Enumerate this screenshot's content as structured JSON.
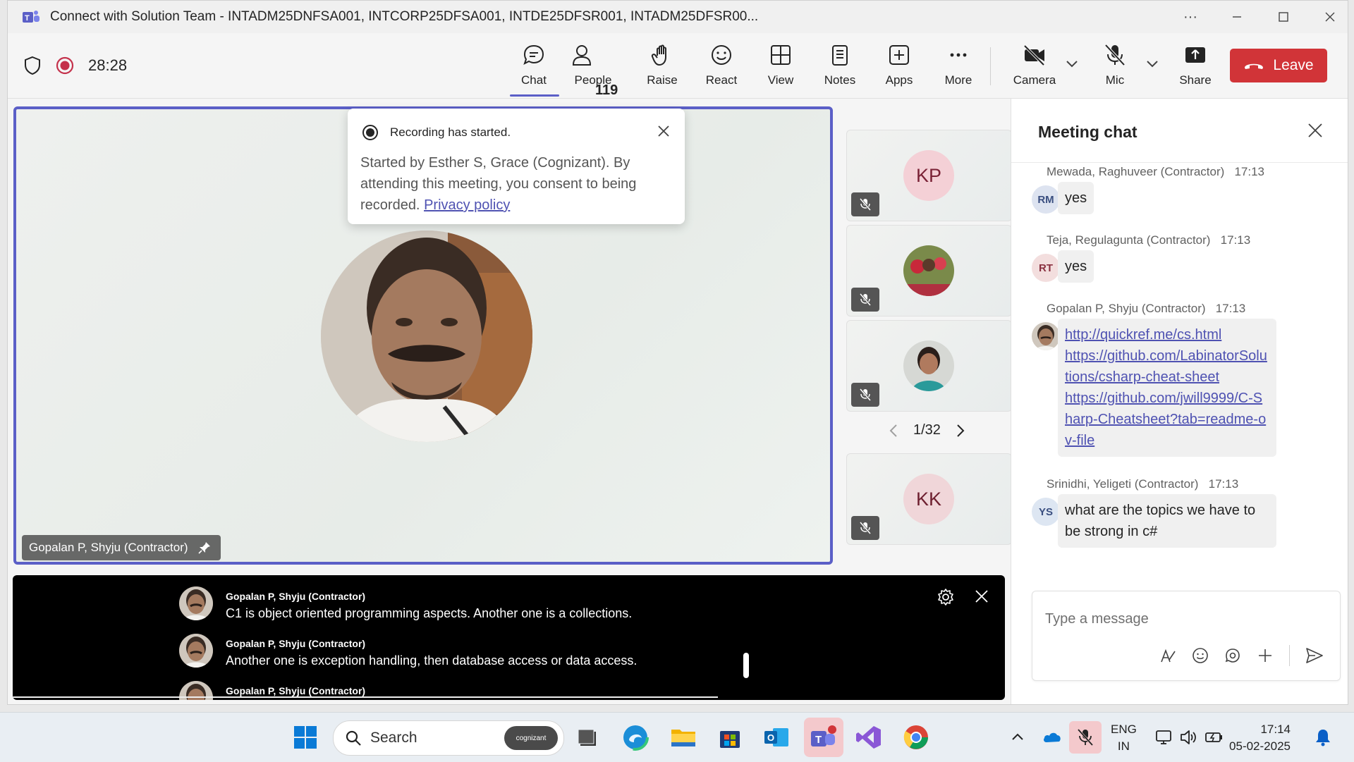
{
  "window": {
    "title": "Connect with Solution Team - INTADM25DNFSA001, INTCORP25DFSA001, INTDE25DFSR001, INTADM25DFSR00..."
  },
  "toolbar": {
    "timer": "28:28",
    "chat": "Chat",
    "people": "People",
    "people_count": "119",
    "raise": "Raise",
    "react": "React",
    "view": "View",
    "notes": "Notes",
    "apps": "Apps",
    "more": "More",
    "camera": "Camera",
    "mic": "Mic",
    "share": "Share",
    "leave": "Leave"
  },
  "toast": {
    "title": "Recording has started.",
    "body": "Started by Esther S, Grace (Cognizant). By attending this meeting, you consent to being recorded.",
    "link": "Privacy policy"
  },
  "stage": {
    "speaker_name": "Gopalan P, Shyju (Contractor)"
  },
  "tiles": [
    {
      "initials": "KP"
    },
    {
      "initials": ""
    },
    {
      "initials": ""
    },
    {
      "initials": "KK"
    }
  ],
  "pager": "1/32",
  "captions": [
    {
      "name": "Gopalan P, Shyju (Contractor)",
      "text": "C1 is object oriented programming aspects. Another one is a collections."
    },
    {
      "name": "Gopalan P, Shyju (Contractor)",
      "text": "Another one is exception handling, then database access or data access."
    },
    {
      "name": "Gopalan P, Shyju (Contractor)",
      "text": ""
    }
  ],
  "chat": {
    "title": "Meeting chat",
    "messages": [
      {
        "sender": "Mewada, Raghuveer (Contractor)",
        "time": "17:13",
        "initials": "RM",
        "text": "yes"
      },
      {
        "sender": "Teja, Regulagunta (Contractor)",
        "time": "17:13",
        "initials": "RT",
        "text": "yes"
      },
      {
        "sender": "Gopalan P, Shyju (Contractor)",
        "time": "17:13",
        "initials": "",
        "links": [
          "http://quickref.me/cs.html",
          "https://github.com/LabinatorSolutions/csharp-cheat-sheet",
          "https://github.com/jwill9999/C-Sharp-Cheatsheet?tab=readme-ov-file"
        ]
      },
      {
        "sender": "Srinidhi, Yeligeti (Contractor)",
        "time": "17:13",
        "initials": "YS",
        "text": "what are the topics we have to be strong in c#"
      }
    ],
    "compose_placeholder": "Type a message"
  },
  "taskbar": {
    "search": "Search",
    "search_badge": "cognizant",
    "lang_top": "ENG",
    "lang_bottom": "IN",
    "time": "17:14",
    "date": "05-02-2025"
  }
}
